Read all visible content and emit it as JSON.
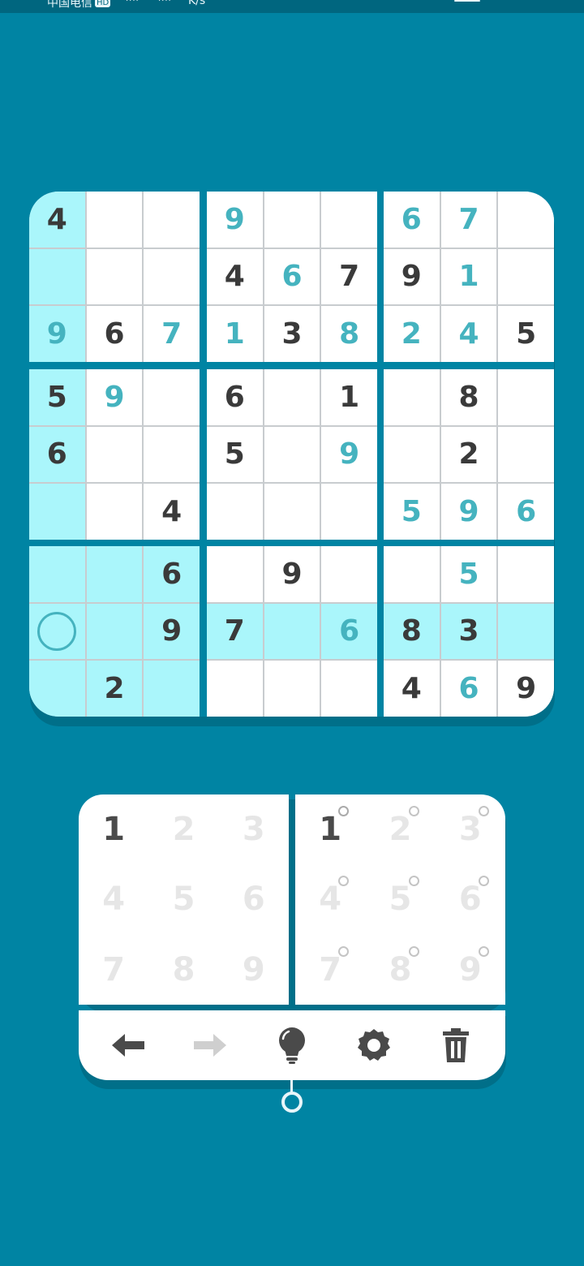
{
  "status_bar": {
    "carrier": "中国电信",
    "hd_badge": "HD",
    "speed_unit": "K/s"
  },
  "board": {
    "rows": [
      [
        "4",
        "",
        "",
        "9",
        "",
        "",
        "6",
        "7",
        ""
      ],
      [
        "",
        "",
        "",
        "4",
        "6",
        "7",
        "9",
        "1",
        ""
      ],
      [
        "9",
        "6",
        "7",
        "1",
        "3",
        "8",
        "2",
        "4",
        "5"
      ],
      [
        "5",
        "9",
        "",
        "6",
        "",
        "1",
        "",
        "8",
        ""
      ],
      [
        "6",
        "",
        "",
        "5",
        "",
        "9",
        "",
        "2",
        ""
      ],
      [
        "",
        "",
        "4",
        "",
        "",
        "",
        "5",
        "9",
        "6"
      ],
      [
        "",
        "",
        "6",
        "",
        "9",
        "",
        "",
        "5",
        ""
      ],
      [
        "",
        "",
        "9",
        "7",
        "",
        "6",
        "8",
        "3",
        ""
      ],
      [
        "",
        "2",
        "",
        "",
        "",
        "",
        "4",
        "6",
        "9"
      ]
    ],
    "user_entered": [
      [
        0,
        3
      ],
      [
        0,
        6
      ],
      [
        0,
        7
      ],
      [
        1,
        4
      ],
      [
        1,
        7
      ],
      [
        2,
        0
      ],
      [
        2,
        2
      ],
      [
        2,
        3
      ],
      [
        2,
        5
      ],
      [
        2,
        6
      ],
      [
        2,
        7
      ],
      [
        3,
        1
      ],
      [
        4,
        5
      ],
      [
        5,
        6
      ],
      [
        5,
        7
      ],
      [
        5,
        8
      ],
      [
        6,
        7
      ],
      [
        7,
        5
      ],
      [
        8,
        7
      ]
    ],
    "highlighted": [
      [
        0,
        0
      ],
      [
        1,
        0
      ],
      [
        2,
        0
      ],
      [
        3,
        0
      ],
      [
        4,
        0
      ],
      [
        5,
        0
      ],
      [
        6,
        0
      ],
      [
        7,
        0
      ],
      [
        8,
        0
      ],
      [
        6,
        1
      ],
      [
        6,
        2
      ],
      [
        7,
        1
      ],
      [
        7,
        2
      ],
      [
        8,
        1
      ],
      [
        8,
        2
      ],
      [
        7,
        3
      ],
      [
        7,
        4
      ],
      [
        7,
        5
      ],
      [
        7,
        6
      ],
      [
        7,
        7
      ],
      [
        7,
        8
      ]
    ],
    "selected_cell": [
      7,
      0
    ],
    "colors": {
      "given": "#3a3a3a",
      "user": "#45b3bf",
      "highlight": "#aaf6fb",
      "background": "#0084a3"
    }
  },
  "number_pad": {
    "keys": [
      "1",
      "2",
      "3",
      "4",
      "5",
      "6",
      "7",
      "8",
      "9"
    ],
    "active_keys": [
      "1"
    ]
  },
  "notes_pad": {
    "keys": [
      "1",
      "2",
      "3",
      "4",
      "5",
      "6",
      "7",
      "8",
      "9"
    ],
    "active_keys": [
      "1"
    ]
  },
  "toolbar": {
    "tools": [
      {
        "name": "undo",
        "icon": "arrow-left-icon",
        "enabled": true
      },
      {
        "name": "redo",
        "icon": "arrow-right-icon",
        "enabled": false
      },
      {
        "name": "hint",
        "icon": "lightbulb-icon",
        "enabled": true
      },
      {
        "name": "settings",
        "icon": "gear-icon",
        "enabled": true
      },
      {
        "name": "erase",
        "icon": "trash-icon",
        "enabled": true
      }
    ]
  }
}
